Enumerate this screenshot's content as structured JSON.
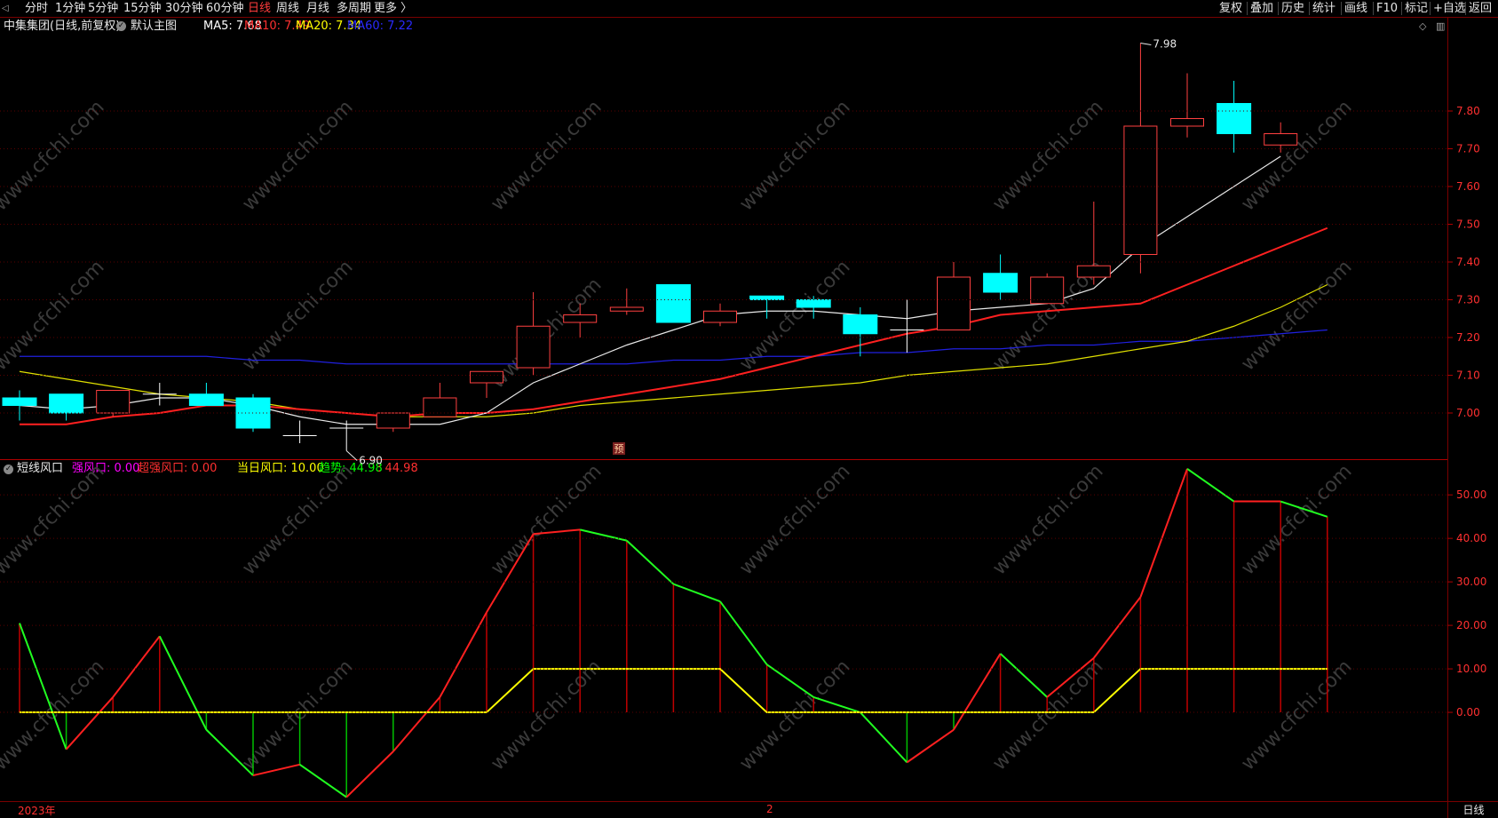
{
  "toolbar": {
    "periods": [
      "分时",
      "1分钟",
      "5分钟",
      "15分钟",
      "30分钟",
      "60分钟",
      "日线",
      "周线",
      "月线",
      "多周期",
      "更多 〉"
    ],
    "active_period": "日线",
    "right_buttons": [
      "复权",
      "叠加",
      "历史",
      "统计",
      "画线",
      "F10",
      "标记",
      "+自选",
      "返回"
    ]
  },
  "main_panel": {
    "stock_title": "中集集团(日线,前复权)",
    "template_name": "默认主图",
    "ma": [
      {
        "label": "MA5: 7.68",
        "color": "#ffffff"
      },
      {
        "label": "MA10: 7.49",
        "color": "#ff3030"
      },
      {
        "label": "MA20: 7.34",
        "color": "#ffff00"
      },
      {
        "label": "MA60: 7.22",
        "color": "#2a2aff"
      }
    ],
    "high_label": "7.98",
    "low_label": "6.90",
    "pre_badge": "预",
    "y_ticks": [
      "7.80",
      "7.70",
      "7.60",
      "7.50",
      "7.40",
      "7.30",
      "7.20",
      "7.10",
      "7.00"
    ],
    "watermark": "www.cfchi.com"
  },
  "indicator_panel": {
    "name": "短线风口",
    "values": [
      {
        "label": "强风口: 0.00",
        "color": "#ff00ff"
      },
      {
        "label": "超强风口: 0.00",
        "color": "#ff3030"
      },
      {
        "label": "当日风口: 10.00",
        "color": "#ffff00"
      },
      {
        "label": "趋势: 44.98",
        "color": "#00ff00"
      },
      {
        "label": ": 44.98",
        "color": "#ff3030"
      }
    ],
    "y_ticks": [
      "50.00",
      "40.00",
      "30.00",
      "20.00",
      "10.00",
      "0.00"
    ]
  },
  "bottom": {
    "year_label": "2023年",
    "month_label": "2",
    "period_label": "日线"
  },
  "chart_data": {
    "type": "candlestick",
    "y_range": [
      6.88,
      8.0
    ],
    "candles": [
      {
        "o": 7.04,
        "h": 7.06,
        "l": 6.98,
        "c": 7.02
      },
      {
        "o": 7.05,
        "h": 7.05,
        "l": 6.98,
        "c": 7.0
      },
      {
        "o": 7.0,
        "h": 7.06,
        "l": 6.99,
        "c": 7.06
      },
      {
        "o": 7.05,
        "h": 7.08,
        "l": 7.02,
        "c": 7.05
      },
      {
        "o": 7.05,
        "h": 7.08,
        "l": 7.02,
        "c": 7.02
      },
      {
        "o": 7.04,
        "h": 7.05,
        "l": 6.95,
        "c": 6.96
      },
      {
        "o": 6.94,
        "h": 6.98,
        "l": 6.92,
        "c": 6.94
      },
      {
        "o": 6.96,
        "h": 6.98,
        "l": 6.9,
        "c": 6.96
      },
      {
        "o": 6.96,
        "h": 7.0,
        "l": 6.95,
        "c": 7.0
      },
      {
        "o": 6.99,
        "h": 7.08,
        "l": 6.99,
        "c": 7.04
      },
      {
        "o": 7.08,
        "h": 7.11,
        "l": 7.04,
        "c": 7.11
      },
      {
        "o": 7.12,
        "h": 7.32,
        "l": 7.1,
        "c": 7.23
      },
      {
        "o": 7.24,
        "h": 7.29,
        "l": 7.2,
        "c": 7.26
      },
      {
        "o": 7.27,
        "h": 7.33,
        "l": 7.26,
        "c": 7.28
      },
      {
        "o": 7.34,
        "h": 7.34,
        "l": 7.24,
        "c": 7.24
      },
      {
        "o": 7.24,
        "h": 7.29,
        "l": 7.23,
        "c": 7.27
      },
      {
        "o": 7.31,
        "h": 7.31,
        "l": 7.25,
        "c": 7.3
      },
      {
        "o": 7.3,
        "h": 7.31,
        "l": 7.25,
        "c": 7.28
      },
      {
        "o": 7.26,
        "h": 7.28,
        "l": 7.15,
        "c": 7.21
      },
      {
        "o": 7.22,
        "h": 7.3,
        "l": 7.16,
        "c": 7.22
      },
      {
        "o": 7.22,
        "h": 7.4,
        "l": 7.22,
        "c": 7.36
      },
      {
        "o": 7.37,
        "h": 7.42,
        "l": 7.3,
        "c": 7.32
      },
      {
        "o": 7.29,
        "h": 7.37,
        "l": 7.29,
        "c": 7.36
      },
      {
        "o": 7.36,
        "h": 7.56,
        "l": 7.34,
        "c": 7.39
      },
      {
        "o": 7.42,
        "h": 7.98,
        "l": 7.37,
        "c": 7.76
      },
      {
        "o": 7.76,
        "h": 7.9,
        "l": 7.73,
        "c": 7.78
      },
      {
        "o": 7.82,
        "h": 7.88,
        "l": 7.69,
        "c": 7.74
      },
      {
        "o": 7.71,
        "h": 7.77,
        "l": 7.69,
        "c": 7.74
      }
    ],
    "ma5": [
      7.02,
      7.01,
      7.02,
      7.04,
      7.04,
      7.02,
      6.99,
      6.97,
      6.97,
      6.97,
      7.0,
      7.08,
      7.13,
      7.18,
      7.22,
      7.26,
      7.27,
      7.27,
      7.26,
      7.25,
      7.27,
      7.28,
      7.29,
      7.33,
      7.44,
      7.52,
      7.6,
      7.68
    ],
    "ma10": [
      6.97,
      6.97,
      6.99,
      7.0,
      7.02,
      7.02,
      7.01,
      7.0,
      6.99,
      7.0,
      7.0,
      7.01,
      7.03,
      7.05,
      7.07,
      7.09,
      7.12,
      7.15,
      7.18,
      7.21,
      7.23,
      7.26,
      7.27,
      7.28,
      7.29,
      7.34,
      7.39,
      7.44,
      7.49
    ],
    "ma20": [
      7.11,
      7.09,
      7.07,
      7.05,
      7.04,
      7.03,
      7.01,
      7.0,
      6.99,
      6.99,
      6.99,
      7.0,
      7.02,
      7.03,
      7.04,
      7.05,
      7.06,
      7.07,
      7.08,
      7.1,
      7.11,
      7.12,
      7.13,
      7.15,
      7.17,
      7.19,
      7.23,
      7.28,
      7.34
    ],
    "ma60": [
      7.15,
      7.15,
      7.15,
      7.15,
      7.15,
      7.14,
      7.14,
      7.13,
      7.13,
      7.13,
      7.13,
      7.13,
      7.13,
      7.13,
      7.14,
      7.14,
      7.15,
      7.15,
      7.16,
      7.16,
      7.17,
      7.17,
      7.18,
      7.18,
      7.19,
      7.19,
      7.2,
      7.21,
      7.22
    ],
    "indicator": {
      "y_range": [
        -20.0,
        58.0
      ],
      "trend": [
        20.5,
        -8.5,
        3.5,
        17.5,
        -4.0,
        -14.5,
        -12.0,
        -19.5,
        -9.0,
        3.5,
        23.0,
        41.0,
        42.0,
        39.5,
        29.5,
        25.5,
        11.0,
        3.5,
        0.0,
        -11.5,
        -4.0,
        13.5,
        3.5,
        12.5,
        26.5,
        56.0,
        48.5,
        48.5,
        44.98
      ],
      "daily": [
        0,
        0,
        0,
        0,
        0,
        0,
        0,
        0,
        0,
        0,
        0,
        10,
        10,
        10,
        10,
        10,
        0,
        0,
        0,
        0,
        0,
        0,
        0,
        0,
        10,
        10,
        10,
        10,
        10
      ]
    }
  }
}
